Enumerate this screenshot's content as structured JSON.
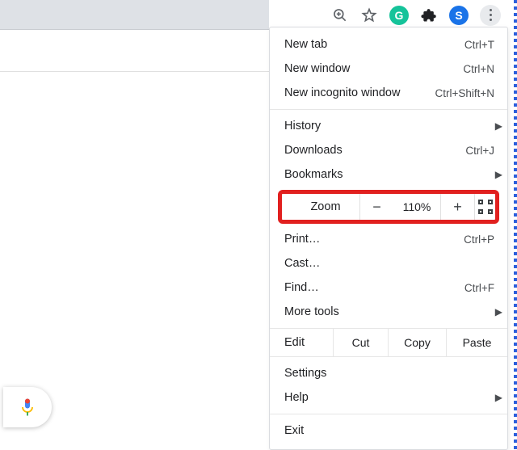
{
  "toolbar_icons": {
    "zoom_in": "zoom-in-icon",
    "star": "bookmark-star-icon",
    "grammarly_initial": "G",
    "puzzle": "extensions-icon",
    "avatar_initial": "S",
    "kebab": "menu-icon"
  },
  "menu": {
    "new_tab": {
      "label": "New tab",
      "shortcut": "Ctrl+T"
    },
    "new_window": {
      "label": "New window",
      "shortcut": "Ctrl+N"
    },
    "new_incognito": {
      "label": "New incognito window",
      "shortcut": "Ctrl+Shift+N"
    },
    "history": {
      "label": "History"
    },
    "downloads": {
      "label": "Downloads",
      "shortcut": "Ctrl+J"
    },
    "bookmarks": {
      "label": "Bookmarks"
    },
    "zoom": {
      "label": "Zoom",
      "value": "110%",
      "minus": "−",
      "plus": "+"
    },
    "print": {
      "label": "Print…",
      "shortcut": "Ctrl+P"
    },
    "cast": {
      "label": "Cast…"
    },
    "find": {
      "label": "Find…",
      "shortcut": "Ctrl+F"
    },
    "more_tools": {
      "label": "More tools"
    },
    "edit": {
      "label": "Edit",
      "cut": "Cut",
      "copy": "Copy",
      "paste": "Paste"
    },
    "settings": {
      "label": "Settings"
    },
    "help": {
      "label": "Help"
    },
    "exit": {
      "label": "Exit"
    }
  }
}
